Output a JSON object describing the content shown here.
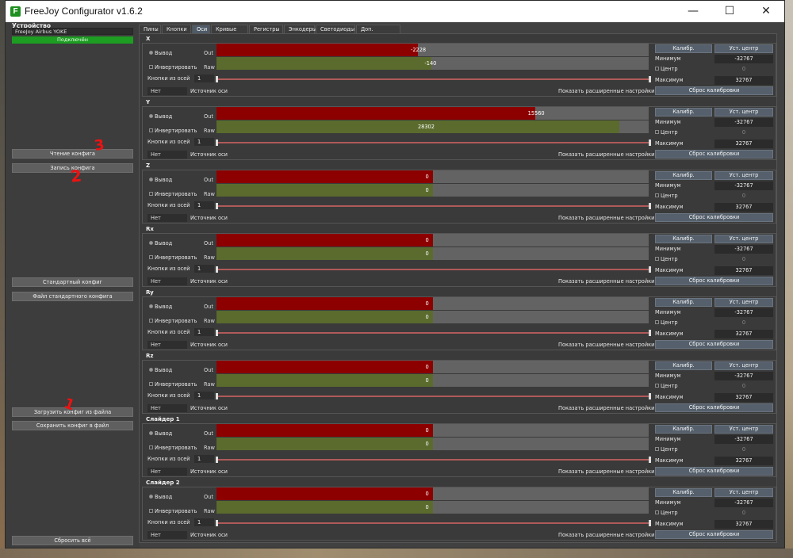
{
  "window": {
    "title": "FreeJoy Configurator v1.6.2",
    "icon_letter": "F"
  },
  "window_controls": {
    "minimize": "—",
    "maximize": "☐",
    "close": "✕"
  },
  "left": {
    "device_label": "Устройство",
    "device_name": "FreeJoy Airbus YOKE",
    "status": "Подключён",
    "buttons": {
      "read_config": "Чтение конфига",
      "write_config": "Запись конфига",
      "default_config": "Стандартный конфиг",
      "default_config_file": "Файл стандартного конфига",
      "load_from_file": "Загрузить конфиг из файла",
      "save_to_file": "Сохранить конфиг в файл",
      "reset_all": "Сбросить всё"
    },
    "annotations": [
      "3",
      "2",
      "1"
    ]
  },
  "tabs": [
    "Пины",
    "Кнопки",
    "Оси",
    "Кривые осей",
    "Регистры",
    "Энкодеры",
    "Светодиоды",
    "Доп. настройки"
  ],
  "active_tab": "Оси",
  "labels": {
    "output": "Вывод",
    "invert": "Инвертировать",
    "out": "Out",
    "raw": "Raw",
    "buttons_from_axis": "Кнопки из осей",
    "none": "Нет",
    "axis_source": "Источник оси",
    "show_advanced": "Показать расширенные настройки",
    "calibrate": "Калибр.",
    "set_center": "Уст. центр",
    "minimum": "Минимум",
    "center": "Центр",
    "maximum": "Максимум",
    "reset_calibration": "Сброс калибровки"
  },
  "colors": {
    "out_bar": "#8c0000",
    "raw_bar": "#5a6b2d",
    "status_green": "#1d9d22"
  },
  "axes": [
    {
      "name": "X",
      "out": "-2228",
      "raw": "-140",
      "out_frac": 0.466,
      "raw_frac": 0.498,
      "buttons_spin": "1",
      "min": "-32767",
      "center": "0",
      "max": "32767"
    },
    {
      "name": "Y",
      "out": "15560",
      "raw": "28302",
      "out_frac": 0.737,
      "raw_frac": 0.932,
      "buttons_spin": "1",
      "min": "-32767",
      "center": "0",
      "max": "32767"
    },
    {
      "name": "Z",
      "out": "0",
      "raw": "0",
      "out_frac": 0.5,
      "raw_frac": 0.5,
      "buttons_spin": "1",
      "min": "-32767",
      "center": "0",
      "max": "32767"
    },
    {
      "name": "Rx",
      "out": "0",
      "raw": "0",
      "out_frac": 0.5,
      "raw_frac": 0.5,
      "buttons_spin": "1",
      "min": "-32767",
      "center": "0",
      "max": "32767"
    },
    {
      "name": "Ry",
      "out": "0",
      "raw": "0",
      "out_frac": 0.5,
      "raw_frac": 0.5,
      "buttons_spin": "1",
      "min": "-32767",
      "center": "0",
      "max": "32767"
    },
    {
      "name": "Rz",
      "out": "0",
      "raw": "0",
      "out_frac": 0.5,
      "raw_frac": 0.5,
      "buttons_spin": "1",
      "min": "-32767",
      "center": "0",
      "max": "32767"
    },
    {
      "name": "Слайдер 1",
      "out": "0",
      "raw": "0",
      "out_frac": 0.5,
      "raw_frac": 0.5,
      "buttons_spin": "1",
      "min": "-32767",
      "center": "0",
      "max": "32767"
    },
    {
      "name": "Слайдер 2",
      "out": "0",
      "raw": "0",
      "out_frac": 0.5,
      "raw_frac": 0.5,
      "buttons_spin": "1",
      "min": "-32767",
      "center": "0",
      "max": "32767"
    }
  ]
}
